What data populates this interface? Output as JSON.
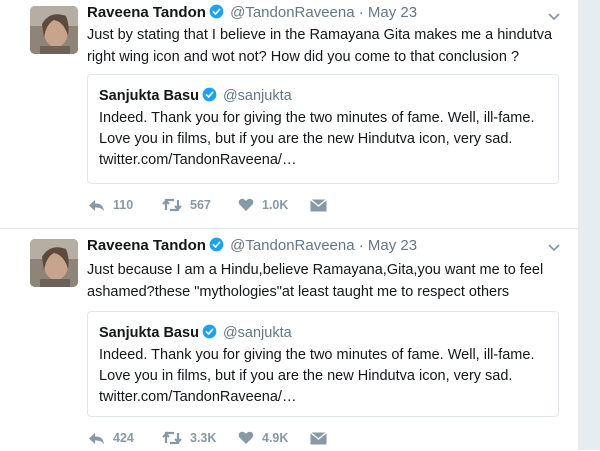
{
  "colors": {
    "verified": "#1da1f2",
    "muted": "#657786",
    "action": "#8899a6",
    "border": "#e1e8ed"
  },
  "tweets": [
    {
      "author": {
        "name": "Raveena Tandon",
        "handle": "@TandonRaveena"
      },
      "separator": "·",
      "date": "May 23",
      "text": "Just by stating that I believe in the Ramayana Gita makes me a hindutva right wing icon and wot not? How did you come to that conclusion ?",
      "quote": {
        "author": {
          "name": "Sanjukta Basu",
          "handle": "@sanjukta"
        },
        "text": "Indeed. Thank you for giving the two minutes of fame. Well, ill-fame. Love you in films, but if you are the new Hindutva icon, very sad. twitter.com/TandonRaveena/…"
      },
      "actions": {
        "reply_count": "110",
        "retweet_count": "567",
        "like_count": "1.0K"
      }
    },
    {
      "author": {
        "name": "Raveena Tandon",
        "handle": "@TandonRaveena"
      },
      "separator": "·",
      "date": "May 23",
      "text": "Just because I am a Hindu,believe Ramayana,Gita,you want me to feel ashamed?these \"mythologies\"at least taught me to respect others",
      "quote": {
        "author": {
          "name": "Sanjukta Basu",
          "handle": "@sanjukta"
        },
        "text": "Indeed. Thank you for giving the two minutes of fame. Well, ill-fame. Love you in films, but if you are the new Hindutva icon, very sad. twitter.com/TandonRaveena/…"
      },
      "actions": {
        "reply_count": "424",
        "retweet_count": "3.3K",
        "like_count": "4.9K"
      }
    }
  ]
}
